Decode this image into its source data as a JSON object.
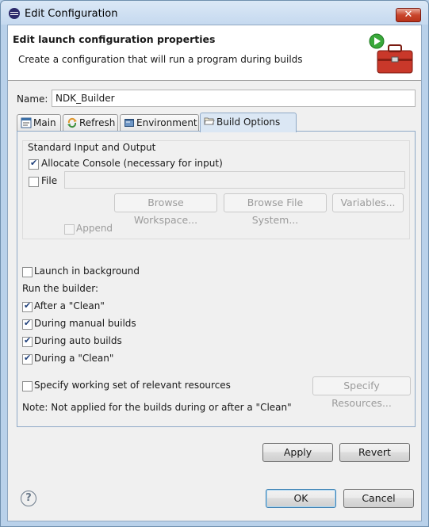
{
  "window": {
    "title": "Edit Configuration",
    "close_label": "✕"
  },
  "header": {
    "title": "Edit launch configuration properties",
    "message": "Create a configuration that will run a program during builds"
  },
  "name_label": "Name:",
  "name_value": "NDK_Builder",
  "tabs": [
    {
      "label": "Main",
      "icon": "main-tab-icon"
    },
    {
      "label": "Refresh",
      "icon": "refresh-icon"
    },
    {
      "label": "Environment",
      "icon": "environment-icon"
    },
    {
      "label": "Build Options",
      "icon": "folder-icon",
      "active": true
    }
  ],
  "std_io": {
    "group_title": "Standard Input and Output",
    "allocate_console_label": "Allocate Console (necessary for input)",
    "allocate_console_checked": true,
    "file_label": "File",
    "file_checked": false,
    "file_value": "",
    "browse_workspace": "Browse Workspace...",
    "browse_file_system": "Browse File System...",
    "variables": "Variables...",
    "append_label": "Append",
    "append_checked": false
  },
  "launch_background": {
    "label": "Launch in background",
    "checked": false
  },
  "run_builder": {
    "label": "Run the builder:",
    "after_clean": {
      "label": "After a \"Clean\"",
      "checked": true
    },
    "manual": {
      "label": "During manual builds",
      "checked": true
    },
    "auto": {
      "label": "During auto builds",
      "checked": true
    },
    "during_clean": {
      "label": "During a \"Clean\"",
      "checked": true
    }
  },
  "working_set": {
    "label": "Specify working set of relevant resources",
    "checked": false,
    "button": "Specify Resources..."
  },
  "note": "Note: Not applied for the builds during or after a \"Clean\"",
  "buttons": {
    "apply": "Apply",
    "revert": "Revert",
    "ok": "OK",
    "cancel": "Cancel"
  },
  "help_icon": "?",
  "colors": {
    "tab_active": "#dbe7f4",
    "close_red": "#c9462c",
    "window_frame": "#b9d1ea"
  }
}
